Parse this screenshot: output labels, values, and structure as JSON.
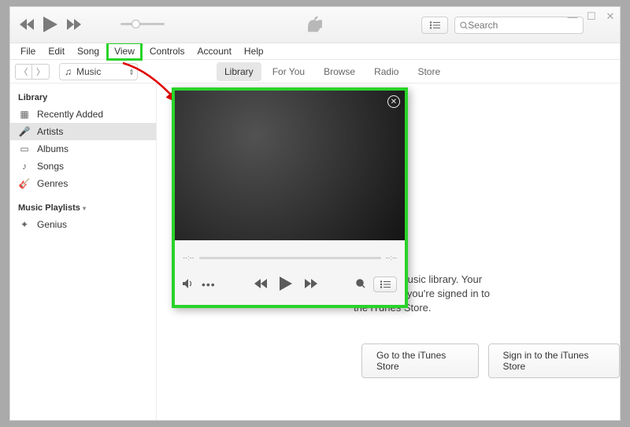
{
  "menubar": [
    "File",
    "Edit",
    "Song",
    "View",
    "Controls",
    "Account",
    "Help"
  ],
  "highlighted_menu_index": 3,
  "search": {
    "placeholder": "Search"
  },
  "media_selector": {
    "label": "Music"
  },
  "tabs": [
    {
      "label": "Library",
      "active": true
    },
    {
      "label": "For You",
      "active": false
    },
    {
      "label": "Browse",
      "active": false
    },
    {
      "label": "Radio",
      "active": false
    },
    {
      "label": "Store",
      "active": false
    }
  ],
  "sidebar": {
    "section1_title": "Library",
    "items1": [
      {
        "label": "Recently Added",
        "icon": "calendar",
        "active": false
      },
      {
        "label": "Artists",
        "icon": "mic",
        "active": true
      },
      {
        "label": "Albums",
        "icon": "album",
        "active": false
      },
      {
        "label": "Songs",
        "icon": "note",
        "active": false
      },
      {
        "label": "Genres",
        "icon": "guitar",
        "active": false
      }
    ],
    "section2_title": "Music Playlists",
    "items2": [
      {
        "label": "Genius",
        "icon": "genius",
        "active": false
      }
    ]
  },
  "main": {
    "message_line1": "ar in your music library. Your",
    "message_line2": "r whenever you're signed in to",
    "message_line3": "the iTunes Store.",
    "btn_store": "Go to the iTunes Store",
    "btn_signin": "Sign in to the iTunes Store"
  },
  "miniplayer": {
    "time_left": "--:--",
    "time_right": "--:--"
  }
}
